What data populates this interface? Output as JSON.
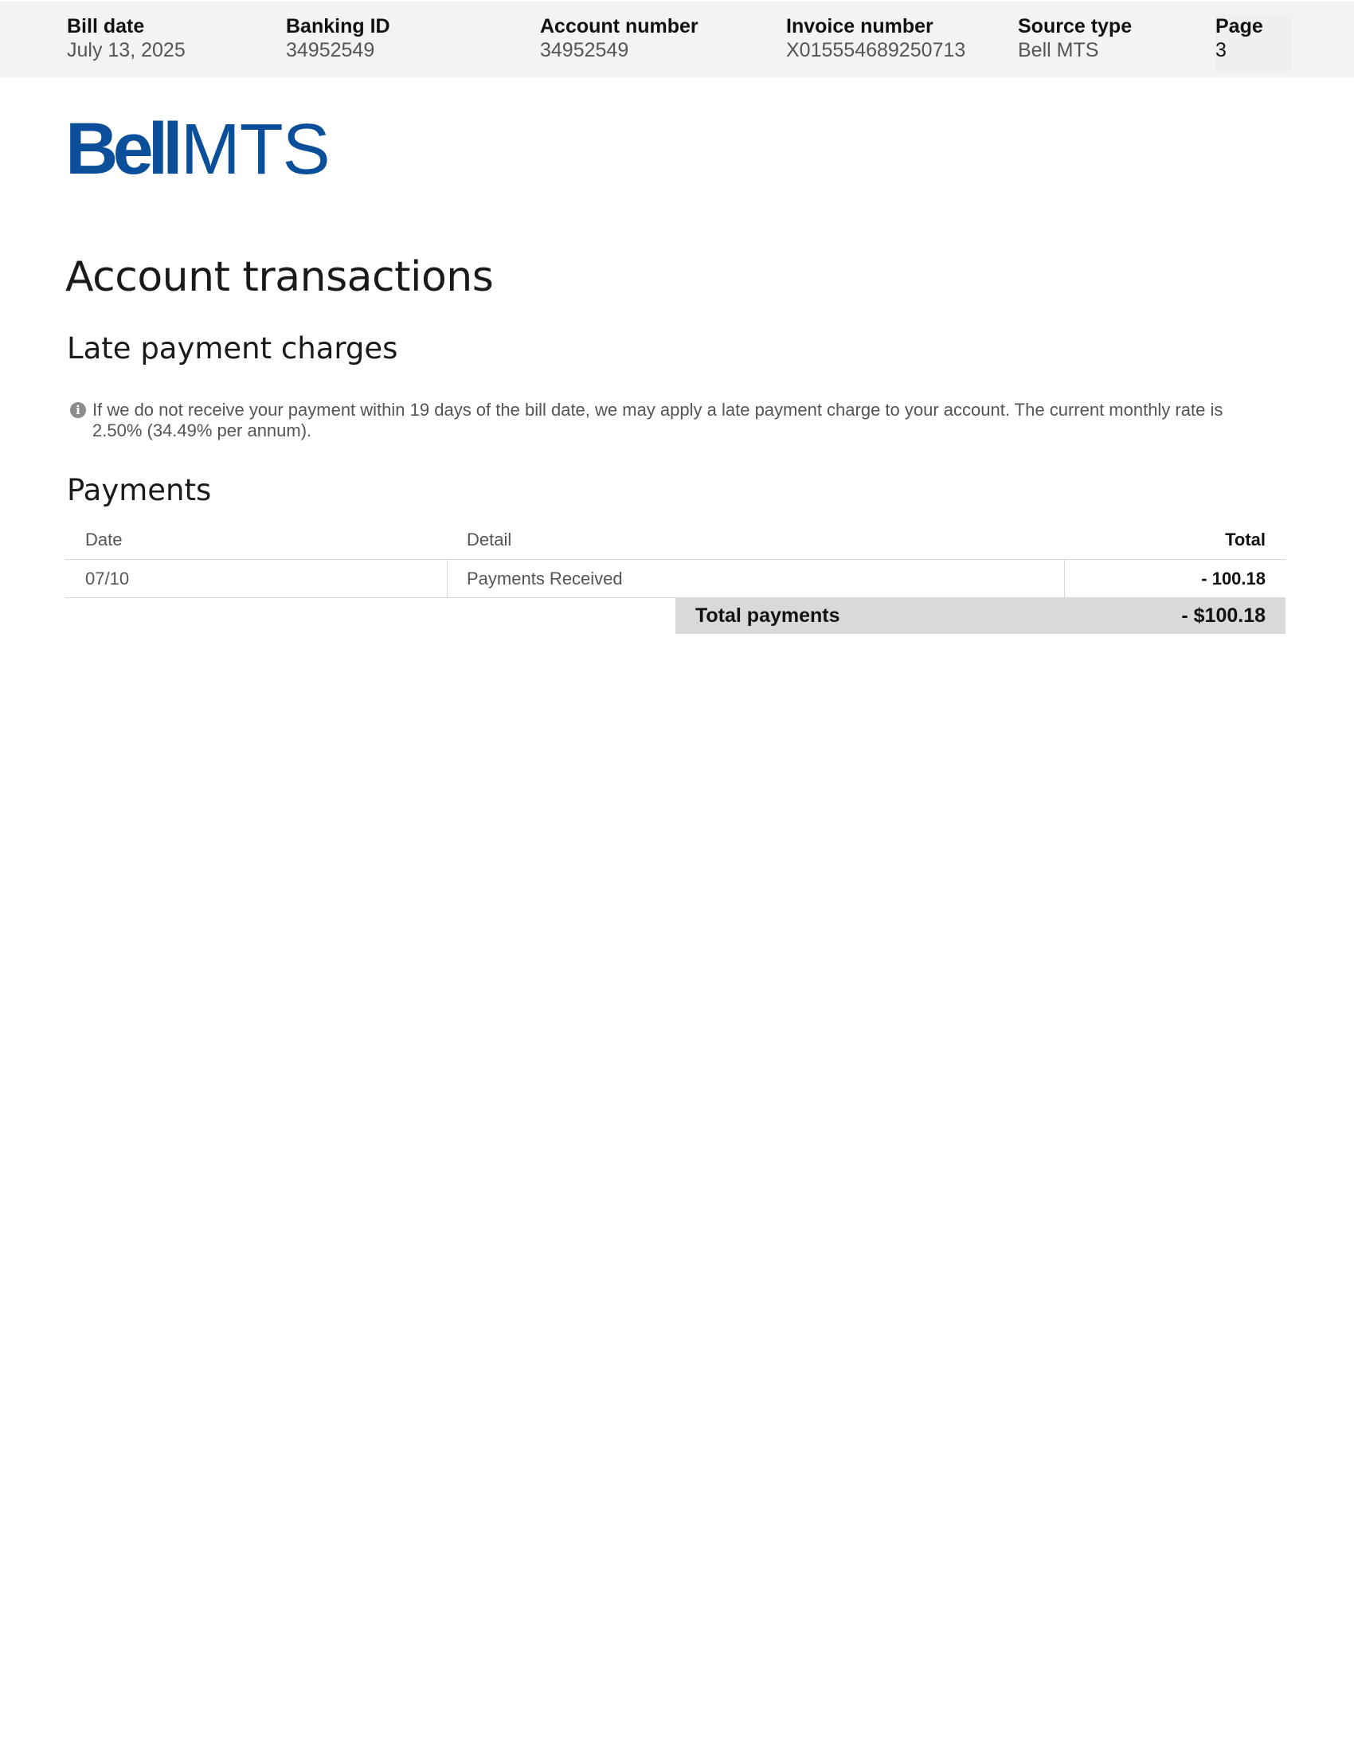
{
  "header": {
    "fields": [
      {
        "label": "Bill date",
        "value": "July 13, 2025"
      },
      {
        "label": "Banking ID",
        "value": "34952549"
      },
      {
        "label": "Account number",
        "value": "34952549"
      },
      {
        "label": "Invoice number",
        "value": "X015554689250713"
      },
      {
        "label": "Source type",
        "value": "Bell MTS"
      },
      {
        "label": "Page",
        "value": "3"
      }
    ]
  },
  "logo": {
    "bell": "Bell",
    "mts": "MTS",
    "color": "#0b4f9b"
  },
  "page_title": "Account transactions",
  "late_payment": {
    "heading": "Late payment charges",
    "icon": "info-icon",
    "note": "If we do not receive your payment within 19 days of the bill date, we may apply a late payment charge to your account. The current monthly rate is 2.50% (34.49% per annum)."
  },
  "payments": {
    "heading": "Payments",
    "columns": {
      "date": "Date",
      "detail": "Detail",
      "total": "Total"
    },
    "rows": [
      {
        "date": "07/10",
        "detail": "Payments Received",
        "total": "- 100.18"
      }
    ],
    "total_label": "Total payments",
    "total_amount": "- $100.18"
  }
}
